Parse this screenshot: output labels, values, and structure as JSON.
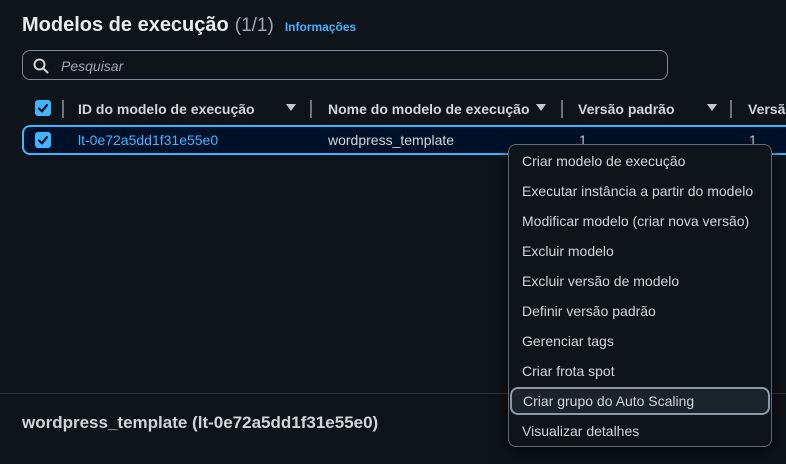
{
  "header": {
    "title": "Modelos de execução",
    "count": "(1/1)",
    "info_link": "Informações"
  },
  "search": {
    "placeholder": "Pesquisar"
  },
  "table": {
    "columns": [
      "ID do modelo de execução",
      "Nome do modelo de execução",
      "Versão padrão",
      "Versão"
    ],
    "rows": [
      {
        "id": "lt-0e72a5dd1f31e55e0",
        "name": "wordpress_template",
        "default_version": "1",
        "latest_version": "1"
      }
    ]
  },
  "context_menu": {
    "items": [
      "Criar modelo de execução",
      "Executar instância a partir do modelo",
      "Modificar modelo (criar nova versão)",
      "Excluir modelo",
      "Excluir versão de modelo",
      "Definir versão padrão",
      "Gerenciar tags",
      "Criar frota spot",
      "Criar grupo do Auto Scaling",
      "Visualizar detalhes"
    ],
    "focused_item": "Criar grupo do Auto Scaling"
  },
  "details": {
    "title": "wordpress_template (lt-0e72a5dd1f31e55e0)"
  },
  "colors": {
    "accent": "#42b4ff",
    "background": "#0f141a",
    "selected_row": "#001129"
  },
  "icons": [
    "search-icon",
    "checkbox-checked-icon",
    "sort-caret-down-icon"
  ]
}
